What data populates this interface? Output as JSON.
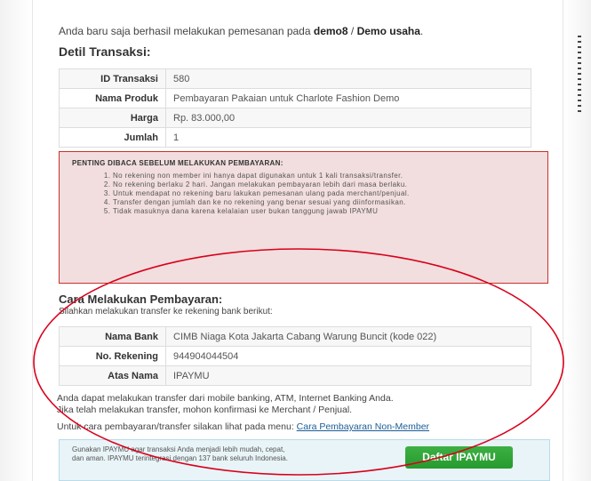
{
  "intro": {
    "prefix": "Anda baru saja berhasil melakukan pemesanan pada ",
    "merchant": "demo8",
    "separator": " / ",
    "business": "Demo usaha",
    "suffix": "."
  },
  "transaction": {
    "title": "Detil Transaksi:",
    "rows": [
      {
        "label": "ID Transaksi",
        "value": "580"
      },
      {
        "label": "Nama Produk",
        "value": "Pembayaran Pakaian untuk Charlote Fashion Demo"
      },
      {
        "label": "Harga",
        "value": "Rp. 83.000,00"
      },
      {
        "label": "Jumlah",
        "value": "1"
      }
    ]
  },
  "warning": {
    "title": "PENTING DIBACA SEBELUM MELAKUKAN PEMBAYARAN:",
    "items": [
      "No rekening non member ini hanya dapat digunakan untuk 1 kali transaksi/transfer.",
      "No rekening berlaku 2 hari. Jangan melakukan pembayaran lebih dari masa berlaku.",
      "Untuk mendapat no rekening baru lakukan pemesanan ulang pada merchant/penjual.",
      "Transfer dengan jumlah dan ke no rekening yang benar sesuai yang diinformasikan.",
      "Tidak masuknya dana karena kelalaian user bukan tanggung jawab IPAYMU"
    ]
  },
  "payment": {
    "title": "Cara Melakukan Pembayaran:",
    "subtitle": "Silahkan melakukan transfer ke rekening bank berikut:",
    "rows": [
      {
        "label": "Nama Bank",
        "value": "CIMB Niaga Kota Jakarta Cabang Warung Buncit (kode 022)"
      },
      {
        "label": "No. Rekening",
        "value": "944904044504"
      },
      {
        "label": "Atas Nama",
        "value": "IPAYMU"
      }
    ]
  },
  "info": {
    "line1": "Anda dapat melakukan transfer dari mobile banking, ATM, Internet Banking Anda.",
    "line2": "Jika telah melakukan transfer, mohon konfirmasi ke Merchant / Penjual."
  },
  "guide": {
    "prefix": "Untuk cara pembayaran/transfer silakan lihat pada menu: ",
    "link": "Cara Pembayaran Non-Member"
  },
  "promo": {
    "text": "Gunakan IPAYMU agar transaksi Anda menjadi lebih mudah, cepat, dan aman. IPAYMU terintegrasi dengan 137 bank seluruh Indonesia.",
    "button": "Daftar IPAYMU"
  },
  "colors": {
    "warning_bg": "#f2dede",
    "warning_border": "#c9302c",
    "annotation": "#d9001b",
    "button_green": "#2fa536",
    "link": "#1a5d97"
  }
}
